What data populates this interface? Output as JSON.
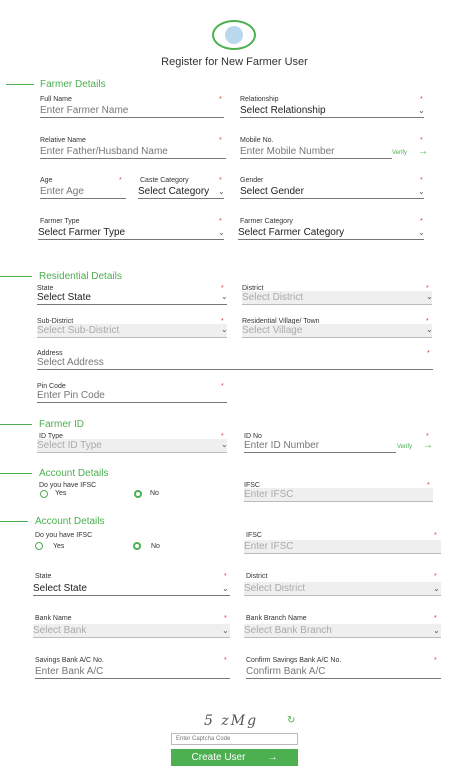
{
  "header": {
    "title": "Register for New Farmer User"
  },
  "farmer_details": {
    "title": "Farmer Details",
    "full_name": {
      "label": "Full Name",
      "placeholder": "Enter Farmer Name"
    },
    "relationship": {
      "label": "Relationship",
      "value": "Select Relationship"
    },
    "relative_name": {
      "label": "Relative Name",
      "placeholder": "Enter Father/Husband Name"
    },
    "mobile": {
      "label": "Mobile No.",
      "placeholder": "Enter Mobile Number",
      "verify": "Verify"
    },
    "age": {
      "label": "Age",
      "placeholder": "Enter Age"
    },
    "caste": {
      "label": "Caste Category",
      "value": "Select Category"
    },
    "gender": {
      "label": "Gender",
      "value": "Select Gender"
    },
    "farmer_type": {
      "label": "Farmer Type",
      "value": "Select Farmer Type"
    },
    "farmer_category": {
      "label": "Farmer Category",
      "value": "Select Farmer Category"
    }
  },
  "residential": {
    "title": "Residential Details",
    "state": {
      "label": "State",
      "value": "Select State"
    },
    "district": {
      "label": "District",
      "value": "Select District"
    },
    "sub_district": {
      "label": "Sub-District",
      "value": "Select Sub-District"
    },
    "village": {
      "label": "Residential Village/ Town",
      "value": "Select Village"
    },
    "address": {
      "label": "Address",
      "placeholder": "Select Address"
    },
    "pin": {
      "label": "Pin Code",
      "placeholder": "Enter Pin Code"
    }
  },
  "farmer_id": {
    "title": "Farmer ID",
    "id_type": {
      "label": "ID Type",
      "value": "Select ID Type"
    },
    "id_no": {
      "label": "ID No",
      "placeholder": "Enter ID Number",
      "verify": "Verify"
    }
  },
  "account_small": {
    "title": "Account Details",
    "ifsc_q": "Do you have IFSC",
    "yes": "Yes",
    "no": "No",
    "ifsc": {
      "label": "IFSC",
      "placeholder": "Enter IFSC"
    }
  },
  "account": {
    "title": "Account Details",
    "ifsc_q": "Do you have IFSC",
    "yes": "Yes",
    "no": "No",
    "ifsc": {
      "label": "IFSC",
      "placeholder": "Enter IFSC"
    },
    "state": {
      "label": "State",
      "value": "Select State"
    },
    "district": {
      "label": "District",
      "value": "Select District"
    },
    "bank": {
      "label": "Bank Name",
      "value": "Select Bank"
    },
    "branch": {
      "label": "Bank Branch Name",
      "value": "Select Bank Branch"
    },
    "acc_no": {
      "label": "Savings Bank A/C No.",
      "placeholder": "Enter Bank A/C"
    },
    "confirm_acc": {
      "label": "Confirm Savings Bank A/C No.",
      "placeholder": "Confirm Bank A/C"
    }
  },
  "captcha": {
    "text": "5 zMg",
    "placeholder": "Enter Captcha Code"
  },
  "submit": {
    "label": "Create User"
  },
  "colors": {
    "accent": "#4caf50",
    "required": "#e53935"
  }
}
